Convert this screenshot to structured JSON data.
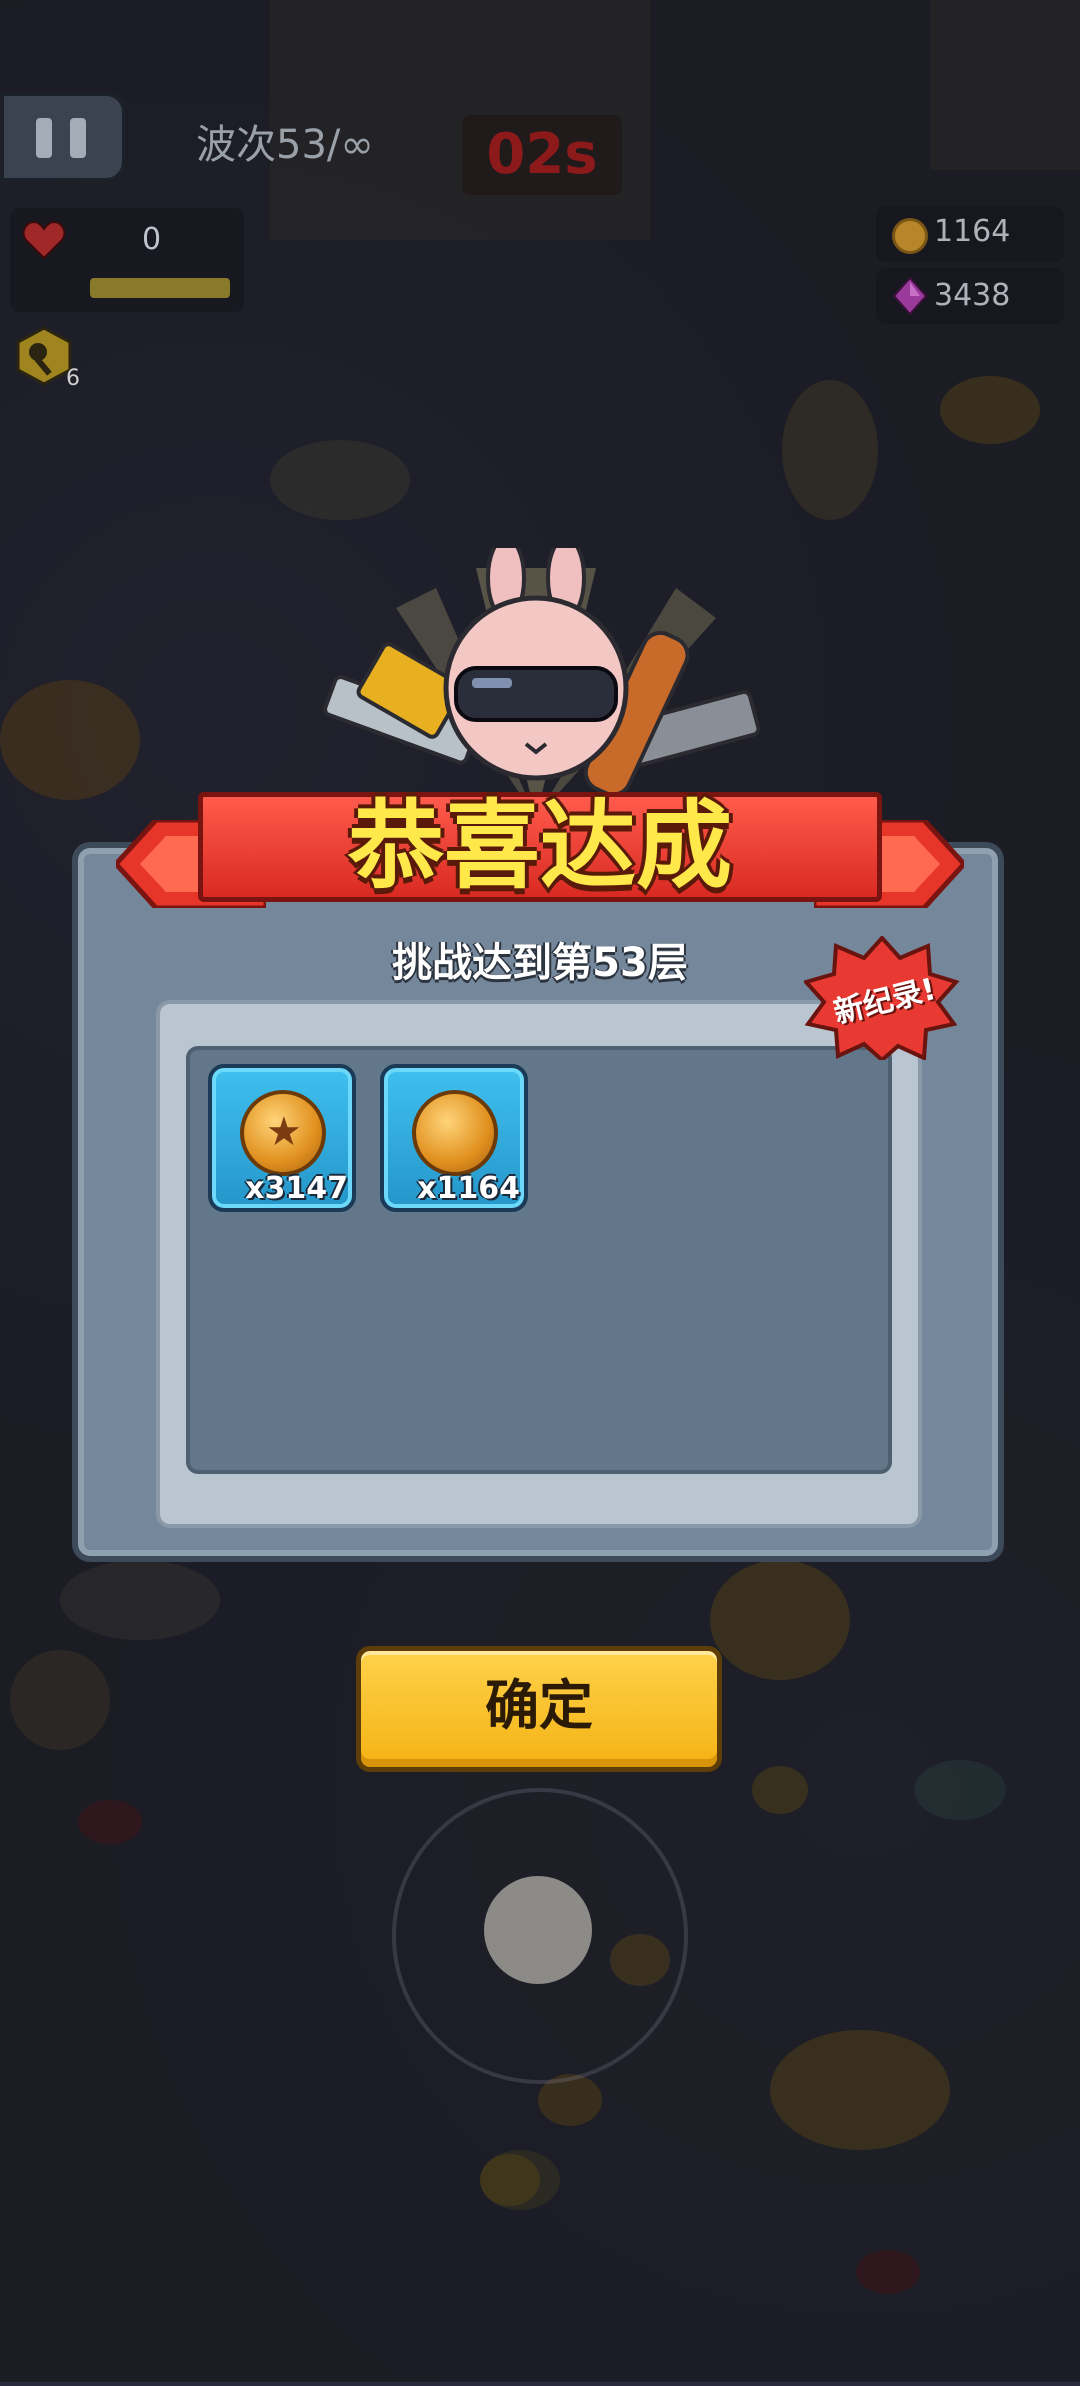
{
  "hud": {
    "wave_label": "波次53/∞",
    "timer": "02s",
    "hp_value": "0",
    "key_count": "6",
    "coins": "1164",
    "gems": "3438"
  },
  "dialog": {
    "title": "恭喜达成",
    "subtitle": "挑战达到第53层",
    "badge": "新纪录!",
    "rewards": [
      {
        "icon": "star-coin-icon",
        "quantity": "x3147"
      },
      {
        "icon": "gold-coin-icon",
        "quantity": "x1164"
      }
    ],
    "confirm_label": "确定"
  },
  "colors": {
    "banner_red": "#e8352a",
    "title_yellow": "#ffe84a",
    "button_yellow": "#f7c22c",
    "reward_blue": "#34b2e6",
    "panel_gray": "#75879a"
  }
}
